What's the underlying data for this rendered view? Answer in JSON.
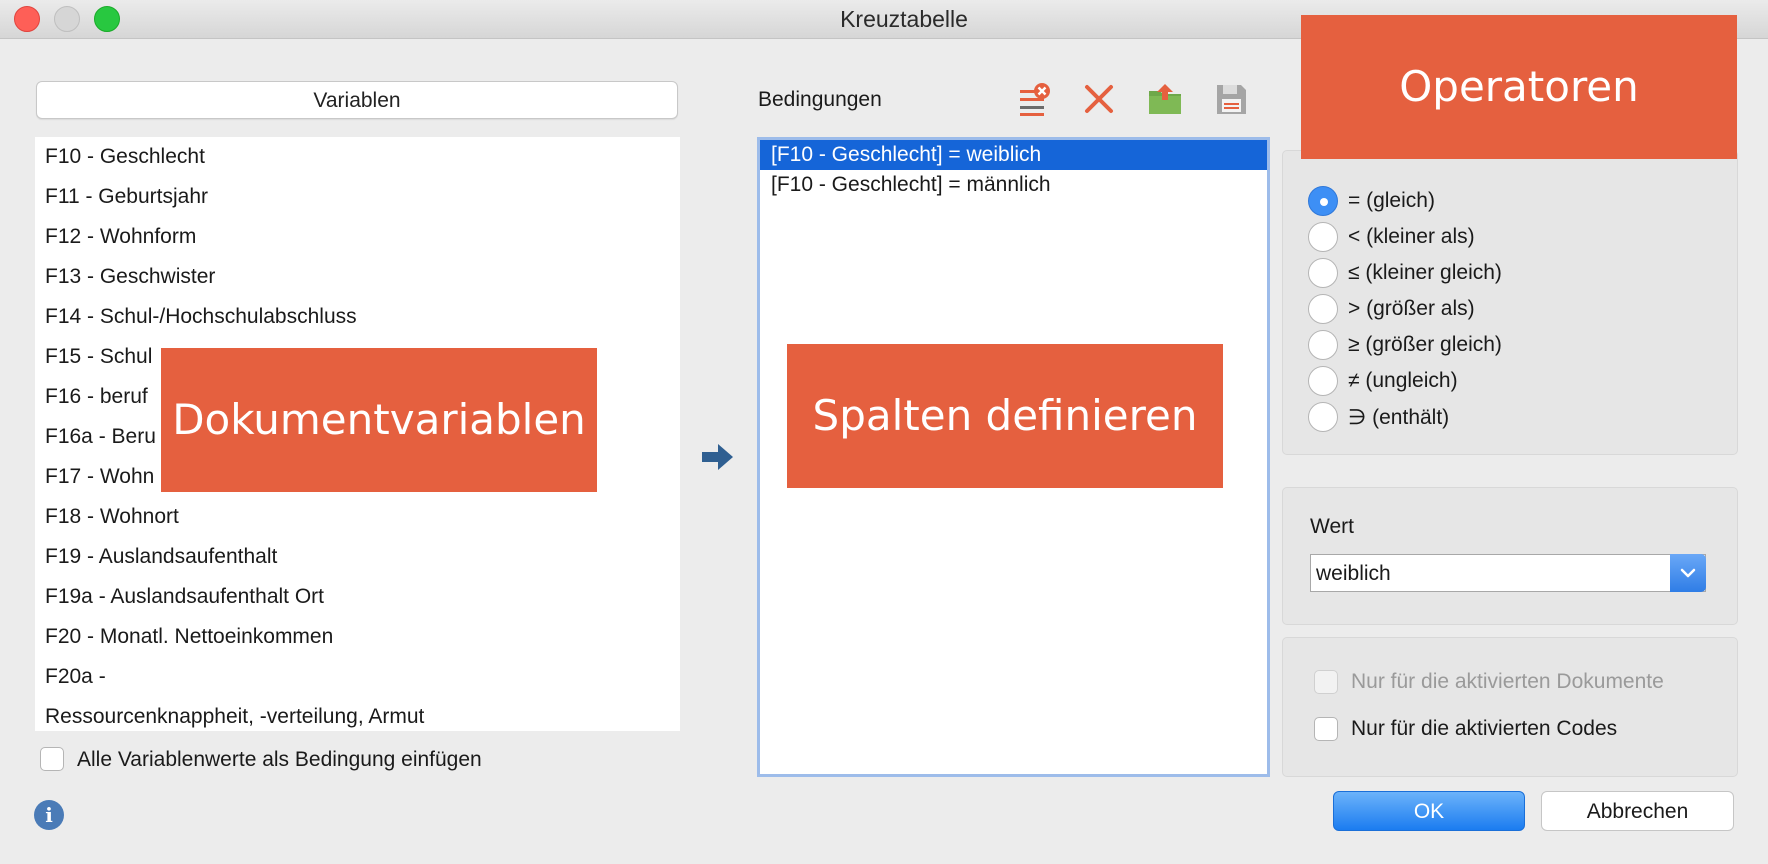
{
  "window": {
    "title": "Kreuztabelle"
  },
  "variables": {
    "header": "Variablen",
    "items": [
      "F10 - Geschlecht",
      "F11 - Geburtsjahr",
      "F12 - Wohnform",
      "F13 - Geschwister",
      "F14 - Schul-/Hochschulabschluss",
      "F15 - Schul",
      "F16 - beruf",
      "F16a - Beru",
      "F17 - Wohn",
      "F18 - Wohnort",
      "F19 - Auslandsaufenthalt",
      "F19a - Auslandsaufenthalt Ort",
      "F20 - Monatl. Nettoeinkommen",
      "F20a -",
      "Ressourcenknappheit, -verteilung, Armut"
    ],
    "insert_all_label": "Alle Variablenwerte als Bedingung einfügen"
  },
  "conditions": {
    "label": "Bedingungen",
    "items": [
      "[F10 - Geschlecht] = weiblich",
      "[F10 - Geschlecht] = männlich"
    ],
    "selected_index": 0,
    "toolbar_icons": [
      "clear-list-icon",
      "delete-icon",
      "open-folder-icon",
      "save-icon"
    ]
  },
  "operators": [
    "= (gleich)",
    "< (kleiner als)",
    "≤ (kleiner gleich)",
    "> (größer als)",
    "≥ (größer gleich)",
    "≠ (ungleich)",
    "∋ (enthält)"
  ],
  "selected_operator": 0,
  "value": {
    "label": "Wert",
    "selected": "weiblich"
  },
  "options": {
    "activated_documents": "Nur für die aktivierten Dokumente",
    "activated_codes": "Nur für die aktivierten Codes"
  },
  "buttons": {
    "ok": "OK",
    "cancel": "Abbrechen"
  },
  "annotations": {
    "operators": "Operatoren",
    "document_variables": "Dokumentvariablen",
    "define_columns": "Spalten definieren"
  },
  "colors": {
    "annotation": "#e5603f",
    "selection": "#1565d8",
    "accent": "#1b7cf0"
  }
}
